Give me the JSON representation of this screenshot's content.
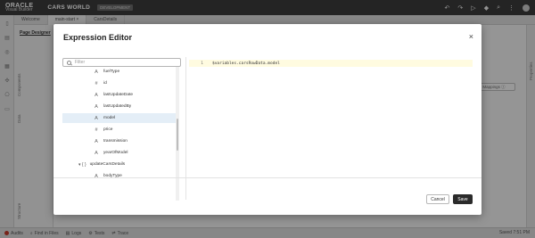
{
  "header": {
    "logo_line1": "ORACLE",
    "logo_line2": "Visual Builder",
    "app_title": "CARS WORLD",
    "env_badge": "DEVELOPMENT"
  },
  "tabs": [
    {
      "label": "Welcome"
    },
    {
      "label": "main-start ×"
    },
    {
      "label": "CarsDetails"
    }
  ],
  "side": {
    "page_designer_tab": "Page Designer",
    "components_label": "Components",
    "data_label": "Data",
    "structure_label": "Structure",
    "properties_label": "Properties"
  },
  "canvas": {
    "ghost_button": "Mappings ⓘ"
  },
  "status_bar": {
    "items": [
      "Audits",
      "Find in Files",
      "Logs",
      "Tests",
      "Trace"
    ],
    "saved": "Saved 7:51 PM"
  },
  "dialog": {
    "title": "Expression Editor",
    "close_symbol": "×",
    "filter_placeholder": "Filter",
    "tree": [
      {
        "icon": "A",
        "label": "fuelType",
        "icon_name": "text-type-icon"
      },
      {
        "icon": "#",
        "label": "id",
        "icon_name": "number-type-icon"
      },
      {
        "icon": "A",
        "label": "lastUpdateDate",
        "icon_name": "text-type-icon"
      },
      {
        "icon": "A",
        "label": "lastUpdatedBy",
        "icon_name": "text-type-icon"
      },
      {
        "icon": "A",
        "label": "model",
        "icon_name": "text-type-icon",
        "selected": true
      },
      {
        "icon": "#",
        "label": "price",
        "icon_name": "number-type-icon"
      },
      {
        "icon": "A",
        "label": "transmission",
        "icon_name": "text-type-icon"
      },
      {
        "icon": "A",
        "label": "yearOfModel",
        "icon_name": "text-type-icon"
      },
      {
        "icon": "▾ { }",
        "label": "updateCarsDetails",
        "icon_name": "object-type-icon"
      },
      {
        "icon": "A",
        "label": "bodyType",
        "icon_name": "text-type-icon"
      }
    ],
    "editor": {
      "line_number": "1",
      "code": "$variables.carsRowData.model"
    },
    "cancel_label": "Cancel",
    "save_label": "Save"
  },
  "colors": {
    "header_bg": "#3a3a3a",
    "selection_bg": "#e4eef7",
    "save_button_bg": "#2b2b2b",
    "status_error": "#c0392b"
  }
}
